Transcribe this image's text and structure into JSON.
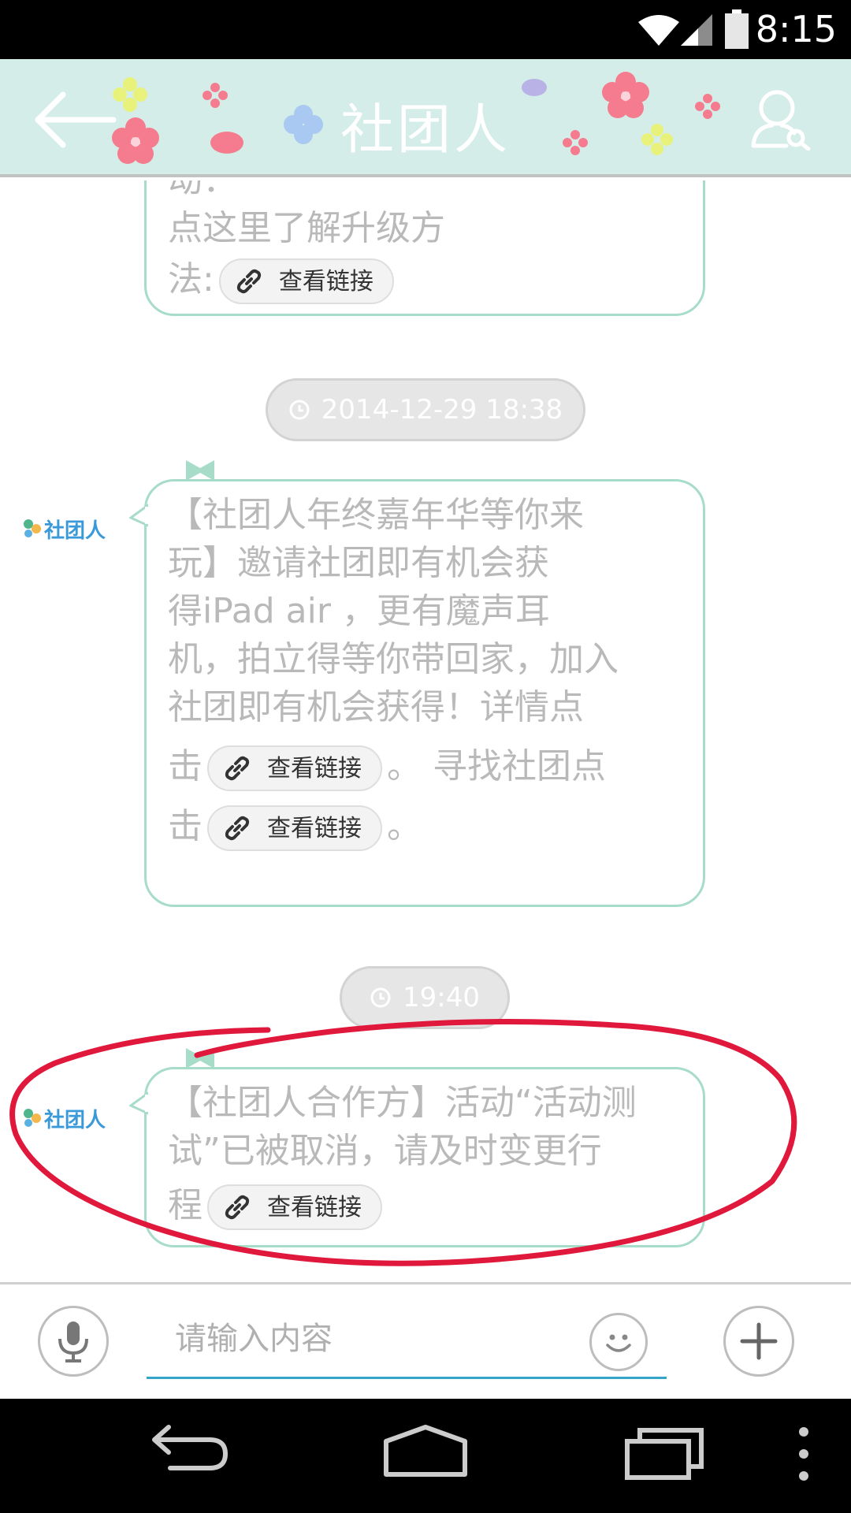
{
  "status_bar": {
    "time": "8:15"
  },
  "header": {
    "title": "社团人",
    "back_icon": "arrow-left-icon",
    "profile_icon": "user-search-icon",
    "background": "#d4ede8"
  },
  "messages": [
    {
      "partial": true,
      "lines": [
        "动：",
        "点这里了解升级方"
      ],
      "last_prefix": "法:",
      "link_label": "查看链接"
    },
    {
      "timestamp": "2014-12-29 18:38",
      "sender_logo": "社团人",
      "lines": [
        "【社团人年终嘉年华等你来",
        "玩】邀请社团即有机会获",
        "得iPad air ，更有魔声耳",
        "机，拍立得等你带回家，加入",
        "社团即有机会获得！详情点"
      ],
      "line6_prefix": "击",
      "line6_suffix": "。 寻找社团点",
      "line7_prefix": "击",
      "line7_suffix": "。",
      "link_label": "查看链接"
    },
    {
      "timestamp": "19:40",
      "sender_logo": "社团人",
      "lines": [
        "【社团人合作方】活动“活动测",
        "试”已被取消，请及时变更行"
      ],
      "last_prefix": "程",
      "link_label": "查看链接"
    }
  ],
  "input": {
    "placeholder": "请输入内容"
  },
  "colors": {
    "bubble_border": "#a6dcc8",
    "highlight": "#e0183c",
    "input_underline": "#35a4c9"
  }
}
